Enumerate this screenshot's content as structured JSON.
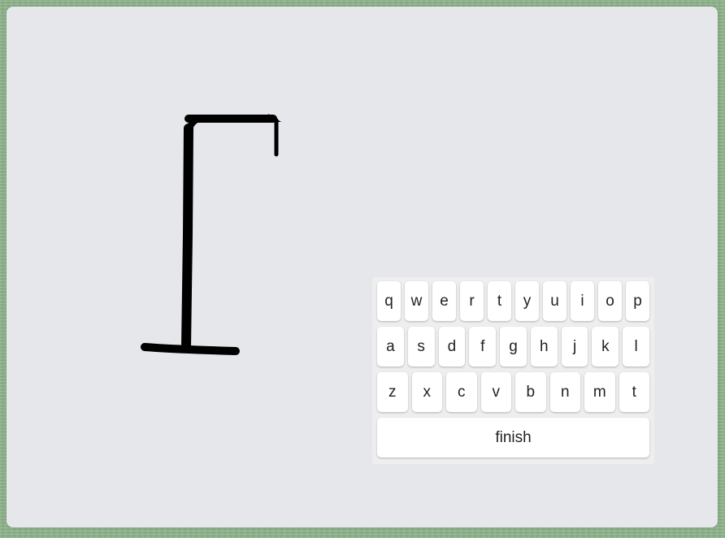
{
  "game": {
    "wrong_guesses": 0
  },
  "colors": {
    "panel": "#e5e7eb",
    "background": "#8fb58c",
    "gallows": "#000000",
    "key": "#ffffff"
  },
  "keyboard": {
    "rows": [
      [
        "q",
        "w",
        "e",
        "r",
        "t",
        "y",
        "u",
        "i",
        "o",
        "p"
      ],
      [
        "a",
        "s",
        "d",
        "f",
        "g",
        "h",
        "j",
        "k",
        "l"
      ],
      [
        "z",
        "x",
        "c",
        "v",
        "b",
        "n",
        "m",
        "t"
      ]
    ],
    "finish_label": "finish"
  }
}
